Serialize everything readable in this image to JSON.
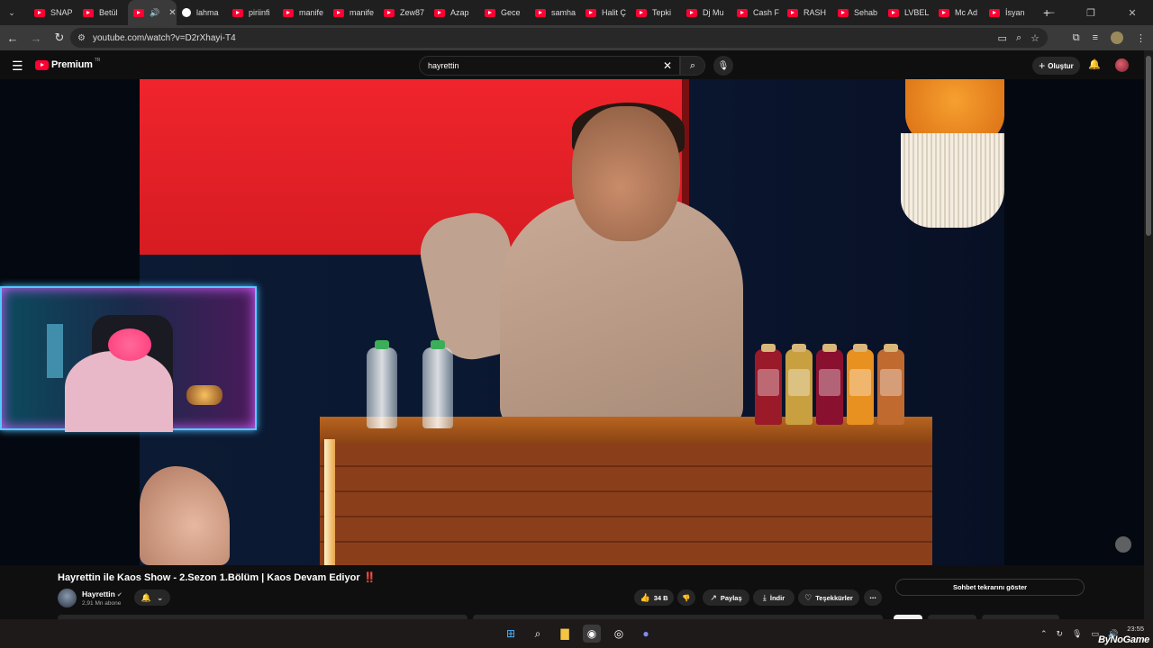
{
  "browser": {
    "tabs": [
      {
        "label": "SNAP",
        "icon": "youtube-icon"
      },
      {
        "label": "Betül",
        "icon": "youtube-icon"
      },
      {
        "label": "",
        "icon": "youtube-icon",
        "active": true
      },
      {
        "label": "lahma",
        "icon": "google-icon"
      },
      {
        "label": "piriinfi",
        "icon": "youtube-icon"
      },
      {
        "label": "manife",
        "icon": "youtube-icon"
      },
      {
        "label": "manife",
        "icon": "youtube-icon"
      },
      {
        "label": "Zew87",
        "icon": "youtube-icon"
      },
      {
        "label": "Azap",
        "icon": "youtube-icon"
      },
      {
        "label": "Gece",
        "icon": "youtube-icon"
      },
      {
        "label": "samha",
        "icon": "youtube-icon"
      },
      {
        "label": "Halit Ç",
        "icon": "youtube-icon"
      },
      {
        "label": "Tepki",
        "icon": "youtube-icon"
      },
      {
        "label": "Dj Mu",
        "icon": "youtube-icon"
      },
      {
        "label": "Cash F",
        "icon": "youtube-icon"
      },
      {
        "label": "RASH",
        "icon": "youtube-icon"
      },
      {
        "label": "Sehab",
        "icon": "youtube-icon"
      },
      {
        "label": "LVBEL",
        "icon": "youtube-icon"
      },
      {
        "label": "Mc Ad",
        "icon": "youtube-icon"
      },
      {
        "label": "İsyan",
        "icon": "youtube-icon"
      }
    ],
    "url": "youtube.com/watch?v=D2rXhayi-T4"
  },
  "youtube": {
    "logo_text": "Premium",
    "logo_region": "TR",
    "search_value": "hayrettin",
    "create_label": "Oluştur"
  },
  "video": {
    "title": "Hayrettin ile Kaos Show - 2.Sezon 1.Bölüm | Kaos Devam Ediyor",
    "title_emoji": "‼️",
    "channel_name": "Hayrettin",
    "subscribers": "2,91 Mn abone",
    "likes": "34 B",
    "share_label": "Paylaş",
    "download_label": "İndir",
    "thanks_label": "Teşekkürler",
    "chat_replay_label": "Sohbet tekrarını göster"
  },
  "taskbar": {
    "time": "23:55"
  },
  "watermark": "ByNoGame",
  "colors": {
    "youtube_red": "#ff0033",
    "background": "#0f0f0f",
    "cam_border": "#55c8ff"
  }
}
